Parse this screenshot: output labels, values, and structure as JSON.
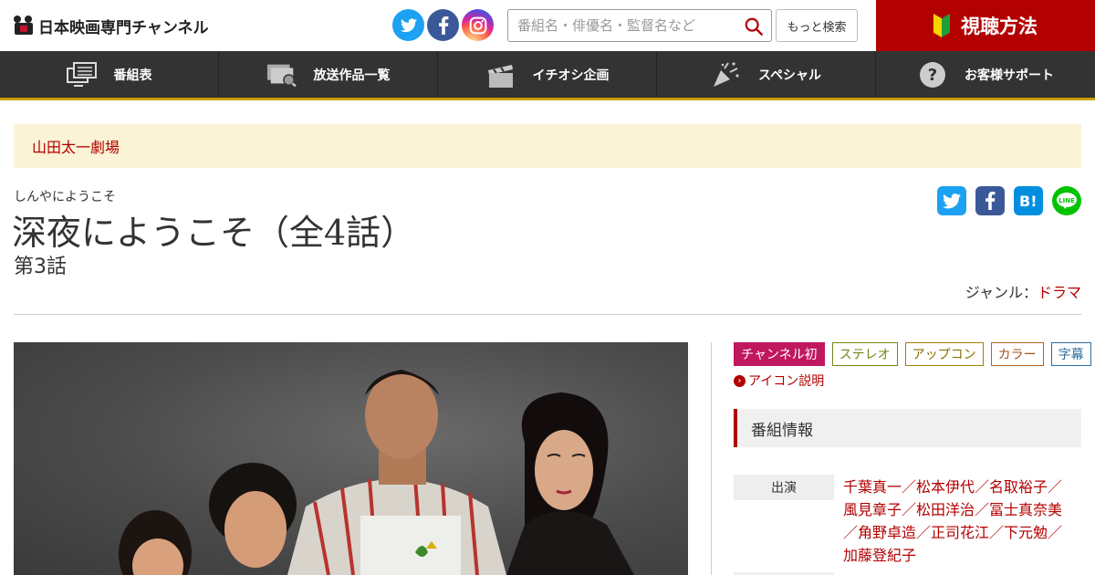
{
  "header": {
    "logo_text": "日本映画専門チャンネル",
    "search_placeholder": "番組名・俳優名・監督名など",
    "more_search_label": "もっと検索",
    "watch_label": "視聴方法"
  },
  "nav": {
    "items": [
      {
        "label": "番組表",
        "icon": "tv-schedule-icon"
      },
      {
        "label": "放送作品一覧",
        "icon": "search-list-icon"
      },
      {
        "label": "イチオシ企画",
        "icon": "clapperboard-icon"
      },
      {
        "label": "スペシャル",
        "icon": "party-popper-icon"
      },
      {
        "label": "お客様サポート",
        "icon": "help-icon"
      }
    ]
  },
  "breadcrumb": {
    "label": "山田太一劇場"
  },
  "program": {
    "kana": "しんやにようこそ",
    "title": "深夜にようこそ（全4話）",
    "episode": "第3話",
    "genre_label": "ジャンル：",
    "genre": "ドラマ"
  },
  "badges": [
    "チャンネル初",
    "ステレオ",
    "アップコン",
    "カラー",
    "字幕"
  ],
  "icon_help_label": "アイコン説明",
  "info": {
    "heading": "番組情報",
    "cast_label": "出演",
    "cast_lines": [
      "千葉真一／松本伊代／名取裕子／",
      "風見章子／松田洋治／冨士真奈美",
      "／角野卓造／正司花江／下元勉／",
      "加藤登紀子"
    ]
  },
  "colors": {
    "accent": "#b30000",
    "nav_bg": "#333333",
    "nav_border": "#c9a000",
    "crumb_bg": "#fbf3d6"
  }
}
